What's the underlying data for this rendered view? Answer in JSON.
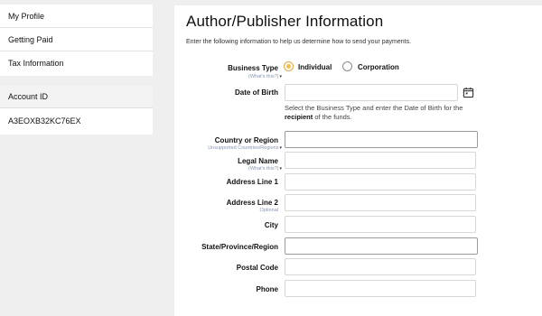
{
  "sidebar": {
    "items": [
      {
        "label": "My Profile"
      },
      {
        "label": "Getting Paid"
      },
      {
        "label": "Tax Information"
      }
    ],
    "account_header": "Account ID",
    "account_id": "A3EOXB32KC76EX"
  },
  "main": {
    "title": "Author/Publisher Information",
    "description": "Enter the following information to help us determine how to send your payments.",
    "business_type": {
      "label": "Business Type",
      "help": "(What's this?)",
      "options": [
        "Individual",
        "Corporation"
      ],
      "selected": "Individual"
    },
    "dob": {
      "label": "Date of Birth",
      "value": "",
      "help_prefix": "Select the Business Type and enter the Date of Birth for the ",
      "help_bold": "recipient",
      "help_suffix": " of the funds."
    },
    "country": {
      "label": "Country or Region",
      "help": "Unsupported Countries/Regions"
    },
    "legal_name": {
      "label": "Legal Name",
      "help": "(What's this?)",
      "value": ""
    },
    "address1": {
      "label": "Address Line 1",
      "value": ""
    },
    "address2": {
      "label": "Address Line 2",
      "optional": "Optional",
      "value": ""
    },
    "city": {
      "label": "City",
      "value": ""
    },
    "state": {
      "label": "State/Province/Region",
      "value": ""
    },
    "postal": {
      "label": "Postal Code",
      "value": ""
    },
    "phone": {
      "label": "Phone",
      "value": ""
    }
  },
  "colors": {
    "accent_radio": "#f0c14b",
    "help_link": "#8a95b5",
    "background": "#efefef"
  }
}
